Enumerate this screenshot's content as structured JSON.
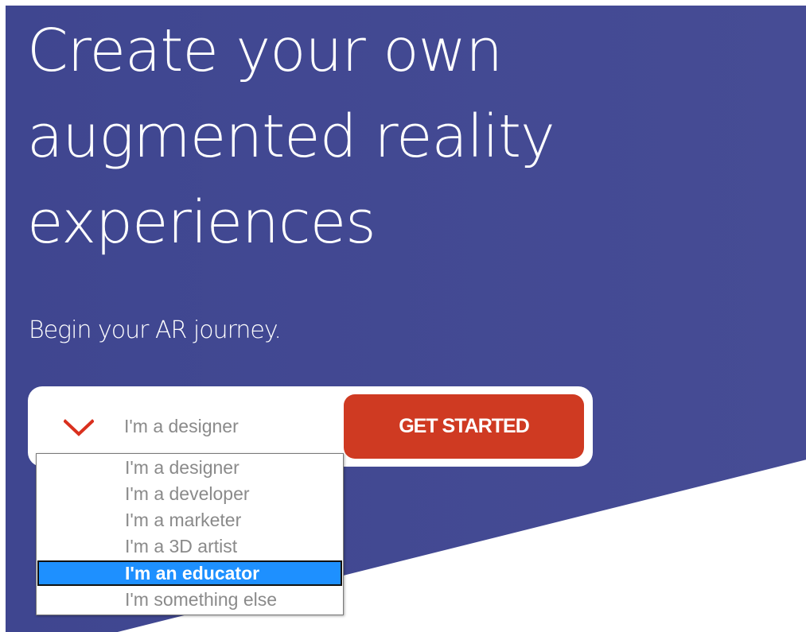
{
  "hero": {
    "headline_lines": [
      "Create your own",
      "augmented reality",
      "experiences"
    ],
    "subheading": "Begin your AR journey."
  },
  "signup": {
    "role_select": {
      "selected_value": "I'm a designer",
      "chevron_icon": "chevron-down-icon",
      "options": [
        "I'm a designer",
        "I'm a developer",
        "I'm a marketer",
        "I'm a 3D artist",
        "I'm an educator",
        "I'm something else"
      ],
      "highlighted_option": "I'm an educator"
    },
    "cta_label": "GET STARTED"
  },
  "colors": {
    "hero_background": "#434992",
    "cta_button": "#cf3a22",
    "chevron": "#d9301e",
    "option_highlight": "#1e90ff",
    "muted_text": "#8a8a8a"
  }
}
